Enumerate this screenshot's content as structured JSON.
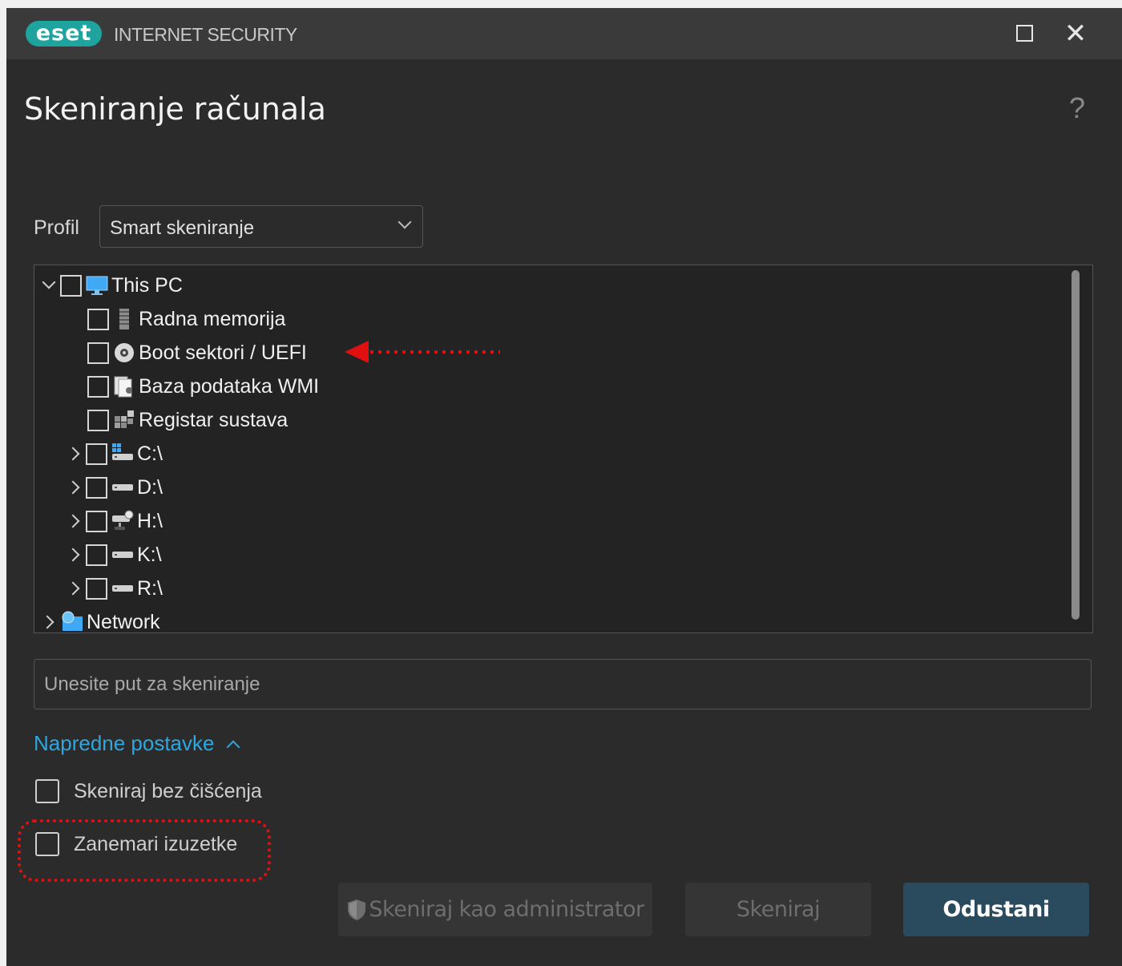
{
  "titlebar": {
    "logo": "eset",
    "app_name": "INTERNET SECURITY",
    "maximize_icon": "maximize-icon",
    "close_icon": "close-icon"
  },
  "page": {
    "title": "Skeniranje računala",
    "help": "?"
  },
  "profile": {
    "label": "Profil",
    "selected": "Smart skeniranje"
  },
  "tree": {
    "items": [
      {
        "label": "This PC",
        "icon": "monitor-icon",
        "expander": "expanded",
        "checked": false
      },
      {
        "label": "Radna memorija",
        "icon": "memory-chip-icon",
        "checked": false
      },
      {
        "label": "Boot sektori / UEFI",
        "icon": "disc-icon",
        "checked": false
      },
      {
        "label": "Baza podataka WMI",
        "icon": "wmi-document-icon",
        "checked": false
      },
      {
        "label": "Registar sustava",
        "icon": "registry-icon",
        "checked": false
      },
      {
        "label": "C:\\",
        "icon": "windows-drive-icon",
        "expander": "collapsed",
        "checked": false
      },
      {
        "label": "D:\\",
        "icon": "drive-icon",
        "expander": "collapsed",
        "checked": false
      },
      {
        "label": "H:\\",
        "icon": "network-drive-icon",
        "expander": "collapsed",
        "checked": false
      },
      {
        "label": "K:\\",
        "icon": "drive-icon",
        "expander": "collapsed",
        "checked": false
      },
      {
        "label": "R:\\",
        "icon": "drive-icon",
        "expander": "collapsed",
        "checked": false
      },
      {
        "label": "Network",
        "icon": "network-globe-icon",
        "expander": "collapsed"
      }
    ]
  },
  "path_input": {
    "placeholder": "Unesite put za skeniranje",
    "value": ""
  },
  "advanced": {
    "label": "Napredne postavke",
    "icon": "chevron-up-icon"
  },
  "options": {
    "no_clean": {
      "label": "Skeniraj bez čišćenja",
      "checked": false
    },
    "ignore_exclusions": {
      "label": "Zanemari izuzetke",
      "checked": false
    }
  },
  "buttons": {
    "scan_admin": "Skeniraj kao administrator",
    "scan": "Skeniraj",
    "cancel": "Odustani",
    "shield_icon": "shield-icon"
  },
  "colors": {
    "accent_link": "#2ea7e0",
    "annotation": "#e01010",
    "primary_button": "#2a4a5e",
    "logo": "#1ea39f"
  }
}
